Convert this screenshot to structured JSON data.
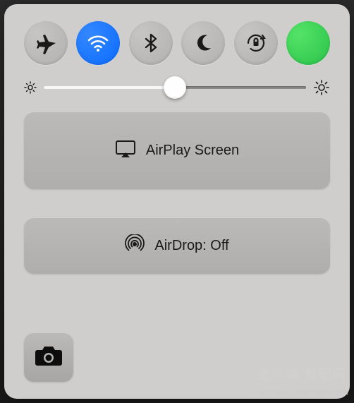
{
  "toggles": {
    "airplane": {
      "active": false
    },
    "wifi": {
      "active": true
    },
    "bluetooth": {
      "active": false
    },
    "dnd": {
      "active": false
    },
    "lock": {
      "active": false
    },
    "extra": {
      "active": true
    }
  },
  "brightness": {
    "percent": 50
  },
  "rows": {
    "airplay": {
      "label": "AirPlay Screen"
    },
    "airdrop": {
      "label": "AirDrop: Off"
    }
  },
  "watermark": {
    "site_cn": "查字典 教程网",
    "site_url": "jiaocheng.chazidian.com"
  },
  "colors": {
    "blue": "#0b6cff",
    "green": "#2bc24a",
    "panel": "#d0cecd",
    "card": "#b5b3b1"
  }
}
